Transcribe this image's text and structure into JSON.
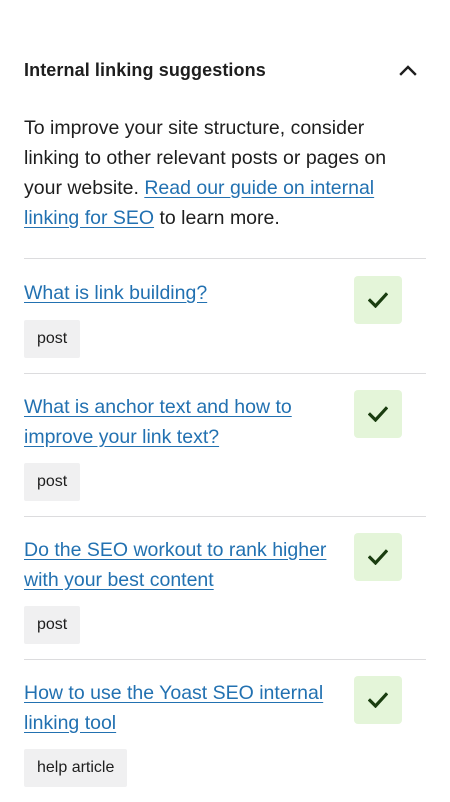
{
  "panel": {
    "title": "Internal linking suggestions",
    "collapse_icon": "chevron-up-icon",
    "intro_text_before": "To improve your site structure, consider linking to other relevant posts or pages on your website. ",
    "intro_link": "Read our guide on internal linking for SEO",
    "intro_text_after": " to learn more."
  },
  "suggestions": [
    {
      "title": "What is link building?",
      "type": "post",
      "icon": "checkmark-icon"
    },
    {
      "title": "What is anchor text and how to improve your link text?",
      "type": "post",
      "icon": "checkmark-icon"
    },
    {
      "title": "Do the SEO workout to rank higher with your best content",
      "type": "post",
      "icon": "checkmark-icon"
    },
    {
      "title": "How to use the Yoast SEO internal linking tool",
      "type": "help article",
      "icon": "checkmark-icon"
    }
  ],
  "colors": {
    "link": "#2271b1",
    "check_bg": "#e4f5d9",
    "check_icon": "#1a3d10",
    "tag_bg": "#f0f0f1",
    "divider": "#dcdcde"
  }
}
